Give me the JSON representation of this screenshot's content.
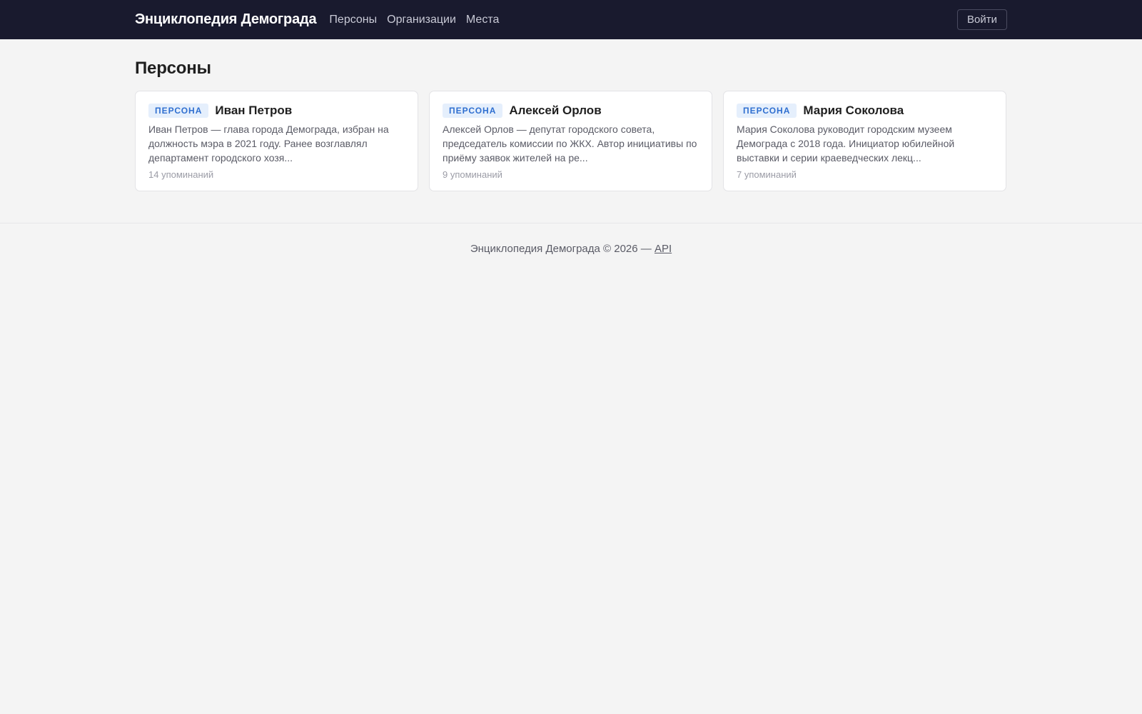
{
  "header": {
    "brand": "Энциклопедия Демограда",
    "nav": [
      "Персоны",
      "Организации",
      "Места"
    ],
    "login_label": "Войти"
  },
  "page": {
    "title": "Персоны"
  },
  "cards": [
    {
      "badge": "ПЕРСОНА",
      "name": "Иван Петров",
      "description": "Иван Петров — глава города Демограда, избран на должность мэра в 2021 году. Ранее возглавлял департамент городского хозя...",
      "mentions": "14 упоминаний"
    },
    {
      "badge": "ПЕРСОНА",
      "name": "Алексей Орлов",
      "description": "Алексей Орлов — депутат городского совета, председатель комиссии по ЖКХ. Автор инициативы по приёму заявок жителей на ре...",
      "mentions": "9 упоминаний"
    },
    {
      "badge": "ПЕРСОНА",
      "name": "Мария Соколова",
      "description": "Мария Соколова руководит городским музеем Демограда с 2018 года. Инициатор юбилейной выставки и серии краеведческих лекц...",
      "mentions": "7 упоминаний"
    }
  ],
  "footer": {
    "text": "Энциклопедия Демограда © 2026 —",
    "link": "API"
  },
  "colors": {
    "header_bg": "#191a2e",
    "page_bg": "#f4f4f4",
    "badge_bg": "#e5effc",
    "badge_text": "#2f6fd0"
  }
}
